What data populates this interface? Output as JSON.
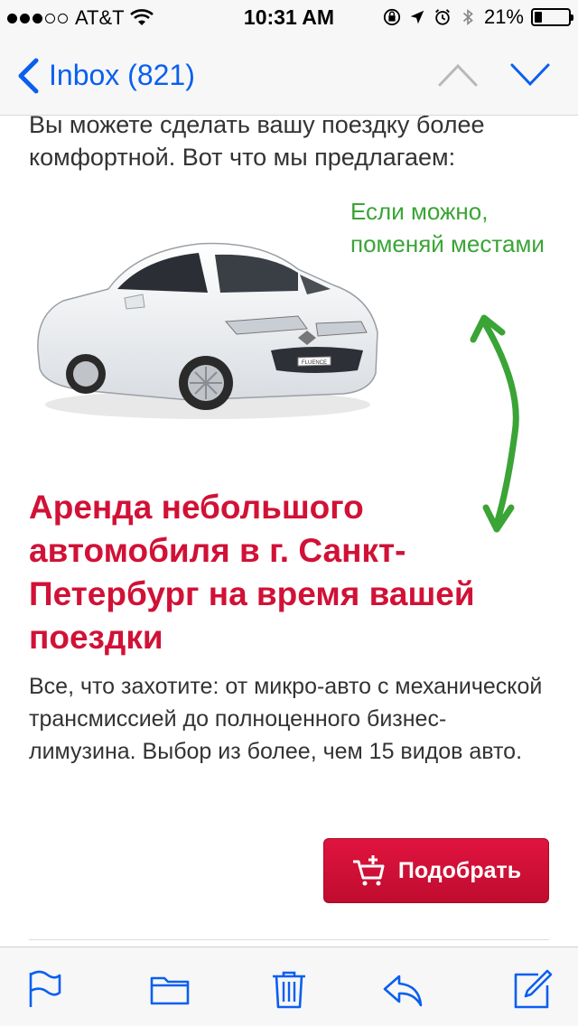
{
  "status": {
    "carrier": "AT&T",
    "time": "10:31 AM",
    "battery": "21%",
    "battery_level": 0.21,
    "signal_bars_filled": 3,
    "signal_bars_total": 5
  },
  "nav": {
    "back_label": "Inbox (821)",
    "accent_color": "#0a5ff0"
  },
  "email": {
    "intro": "Вы можете сделать вашу поездку более комфортной. Вот что мы предлагаем:",
    "car_badge": "FLUENCE",
    "annotation": "Если можно, поменяй местами",
    "headline": "Аренда небольшого автомобиля в г. Санкт-Петербург на время вашей поездки",
    "body": "Все, что захотите: от микро-авто с механической трансмиссией до полноценного бизнес-лимузина. Выбор из более, чем 15 видов авто.",
    "cta_label": "Подобрать",
    "headline_color": "#d11136",
    "annotation_color": "#3aa436"
  },
  "toolbar": {
    "icons": [
      "flag-icon",
      "folder-icon",
      "trash-icon",
      "reply-icon",
      "compose-icon"
    ]
  }
}
